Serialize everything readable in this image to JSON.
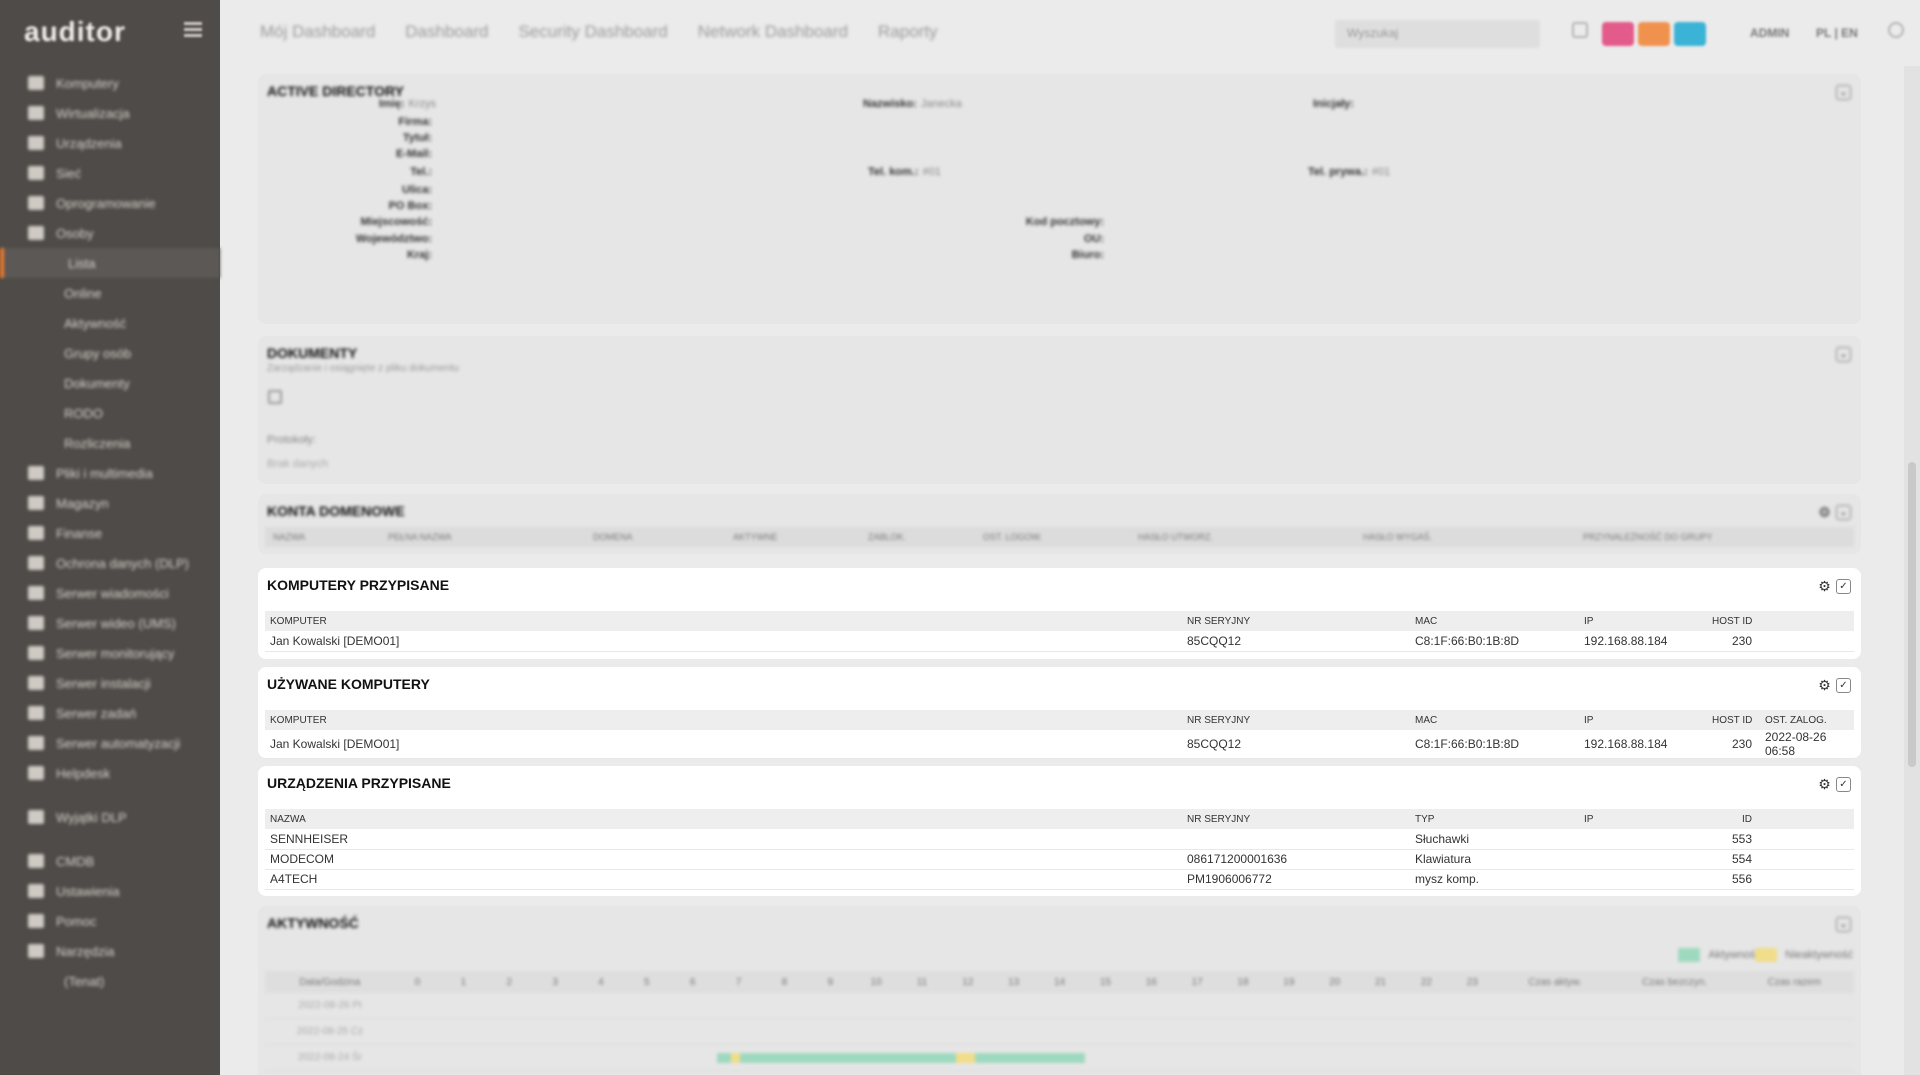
{
  "app": {
    "logo": "auditor"
  },
  "sidebar": {
    "items": [
      {
        "label": "Komputery",
        "type": "main"
      },
      {
        "label": "Wirtualizacja",
        "type": "main"
      },
      {
        "label": "Urządzenia",
        "type": "main"
      },
      {
        "label": "Sieć",
        "type": "main"
      },
      {
        "label": "Oprogramowanie",
        "type": "main"
      },
      {
        "label": "Osoby",
        "type": "main"
      },
      {
        "label": "Lista",
        "type": "sub",
        "active": true
      },
      {
        "label": "Online",
        "type": "sub"
      },
      {
        "label": "Aktywność",
        "type": "sub"
      },
      {
        "label": "Grupy osób",
        "type": "sub"
      },
      {
        "label": "Dokumenty",
        "type": "sub"
      },
      {
        "label": "RODO",
        "type": "sub"
      },
      {
        "label": "Rozliczenia",
        "type": "sub"
      },
      {
        "label": "Pliki i multimedia",
        "type": "main"
      },
      {
        "label": "Magazyn",
        "type": "main"
      },
      {
        "label": "Finanse",
        "type": "main"
      },
      {
        "label": "Ochrona danych (DLP)",
        "type": "main"
      },
      {
        "label": "Serwer wiadomości",
        "type": "main"
      },
      {
        "label": "Serwer wideo (UMS)",
        "type": "main"
      },
      {
        "label": "Serwer monitorujący",
        "type": "main"
      },
      {
        "label": "Serwer instalacji",
        "type": "main"
      },
      {
        "label": "Serwer zadań",
        "type": "main"
      },
      {
        "label": "Serwer automatyzacji",
        "type": "main"
      },
      {
        "label": "Helpdesk",
        "type": "main"
      },
      {
        "label": "Wyjątki DLP",
        "type": "main",
        "gap_before": true
      },
      {
        "label": "CMDB",
        "type": "main",
        "gap_before": true
      },
      {
        "label": "Ustawienia",
        "type": "main"
      },
      {
        "label": "Pomoc",
        "type": "main"
      },
      {
        "label": "Narzędzia",
        "type": "main"
      },
      {
        "label": "(Tenat)",
        "type": "sub"
      }
    ]
  },
  "topbar": {
    "nav": [
      "Mój Dashboard",
      "Dashboard",
      "Security Dashboard",
      "Network Dashboard",
      "Raporty"
    ],
    "search_placeholder": "Wyszukaj",
    "badges": [
      {
        "label": "",
        "color": "#e35b8a"
      },
      {
        "label": "",
        "color": "#f0924e"
      },
      {
        "label": "",
        "color": "#3bb3d6"
      }
    ],
    "user_label": "ADMIN",
    "lang_label": "PL | EN"
  },
  "active_directory": {
    "title": "ACTIVE DIRECTORY",
    "fields": [
      {
        "label": "Imię:",
        "value": "Krzys"
      },
      {
        "label": "Nazwisko:",
        "value": "Janecka"
      },
      {
        "label": "Inicjały:",
        "value": ""
      },
      {
        "label": "Firma:",
        "value": ""
      },
      {
        "label": "Tytuł:",
        "value": ""
      },
      {
        "label": "E-Mail:",
        "value": ""
      },
      {
        "label": "Tel.:",
        "value": ""
      },
      {
        "label": "Tel. kom.:",
        "value": "#01"
      },
      {
        "label": "Tel. prywa.:",
        "value": "#01"
      },
      {
        "label": "Ulica:",
        "value": ""
      },
      {
        "label": "PO Box:",
        "value": ""
      },
      {
        "label": "Miejscowość:",
        "value": ""
      },
      {
        "label": "Kod pocztowy:",
        "value": ""
      },
      {
        "label": "Województwo:",
        "value": ""
      },
      {
        "label": "OU:",
        "value": ""
      },
      {
        "label": "Kraj:",
        "value": ""
      },
      {
        "label": "Biuro:",
        "value": ""
      }
    ]
  },
  "documents": {
    "title": "DOKUMENTY",
    "subtitle": "Zarządzanie i osiągnięte z pliku dokumentu",
    "protocols_label": "Protokoły:",
    "protocols_value": "Brak danych"
  },
  "domain_accounts": {
    "title": "KONTA DOMENOWE",
    "columns": [
      "NAZWA",
      "PEŁNA NAZWA",
      "DOMENA",
      "AKTYWNE",
      "ZABLOK.",
      "OST. LOGOW.",
      "HASŁO UTWORZ.",
      "HASŁO WYGAŚ.",
      "PRZYNALEŻNOŚĆ DO GRUPY"
    ]
  },
  "assigned_computers": {
    "title": "KOMPUTERY PRZYPISANE",
    "columns": {
      "computer": "KOMPUTER",
      "serial": "NR SERYJNY",
      "mac": "MAC",
      "ip": "IP",
      "host_id": "HOST ID"
    },
    "rows": [
      {
        "computer": "Jan Kowalski [DEMO01]",
        "serial": "85CQQ12",
        "mac": "C8:1F:66:B0:1B:8D",
        "ip": "192.168.88.184",
        "host_id": "230"
      }
    ]
  },
  "used_computers": {
    "title": "UŻYWANE KOMPUTERY",
    "columns": {
      "computer": "KOMPUTER",
      "serial": "NR SERYJNY",
      "mac": "MAC",
      "ip": "IP",
      "host_id": "HOST ID",
      "last_login": "OST. ZALOG."
    },
    "rows": [
      {
        "computer": "Jan Kowalski [DEMO01]",
        "serial": "85CQQ12",
        "mac": "C8:1F:66:B0:1B:8D",
        "ip": "192.168.88.184",
        "host_id": "230",
        "last_login": "2022-08-26 06:58"
      }
    ]
  },
  "assigned_devices": {
    "title": "URZĄDZENIA PRZYPISANE",
    "columns": {
      "name": "NAZWA",
      "serial": "NR SERYJNY",
      "type": "TYP",
      "ip": "IP",
      "id": "ID"
    },
    "rows": [
      {
        "name": "SENNHEISER",
        "serial": "",
        "type": "Słuchawki",
        "ip": "",
        "id": "553"
      },
      {
        "name": "MODECOM",
        "serial": "086171200001636",
        "type": "Klawiatura",
        "ip": "",
        "id": "554"
      },
      {
        "name": "A4TECH",
        "serial": "PM1906006772",
        "type": "mysz komp.",
        "ip": "",
        "id": "556"
      }
    ]
  },
  "activity": {
    "title": "AKTYWNOŚĆ",
    "legend": [
      {
        "label": "Aktywność",
        "color": "#9ed9bf"
      },
      {
        "label": "Nieaktywność",
        "color": "#f1dd8a"
      }
    ],
    "first_column": "Data/Godzina",
    "hours": [
      "0",
      "1",
      "2",
      "3",
      "4",
      "5",
      "6",
      "7",
      "8",
      "9",
      "10",
      "11",
      "12",
      "13",
      "14",
      "15",
      "16",
      "17",
      "18",
      "19",
      "20",
      "21",
      "22",
      "23"
    ],
    "summary_columns": [
      "Czas aktyw.",
      "Czas bezczyn.",
      "Czas razem"
    ],
    "rows": [
      {
        "date": "2022-08-26 Pt",
        "segments": []
      },
      {
        "date": "2022-08-25 Cz",
        "segments": []
      },
      {
        "date": "2022-08-24 Śr",
        "segments": [
          {
            "start": 7.0,
            "end": 7.3,
            "state": "active"
          },
          {
            "start": 7.3,
            "end": 7.5,
            "state": "idle"
          },
          {
            "start": 7.5,
            "end": 12.2,
            "state": "active"
          },
          {
            "start": 12.2,
            "end": 12.6,
            "state": "idle"
          },
          {
            "start": 12.6,
            "end": 15.0,
            "state": "active"
          }
        ]
      }
    ]
  }
}
